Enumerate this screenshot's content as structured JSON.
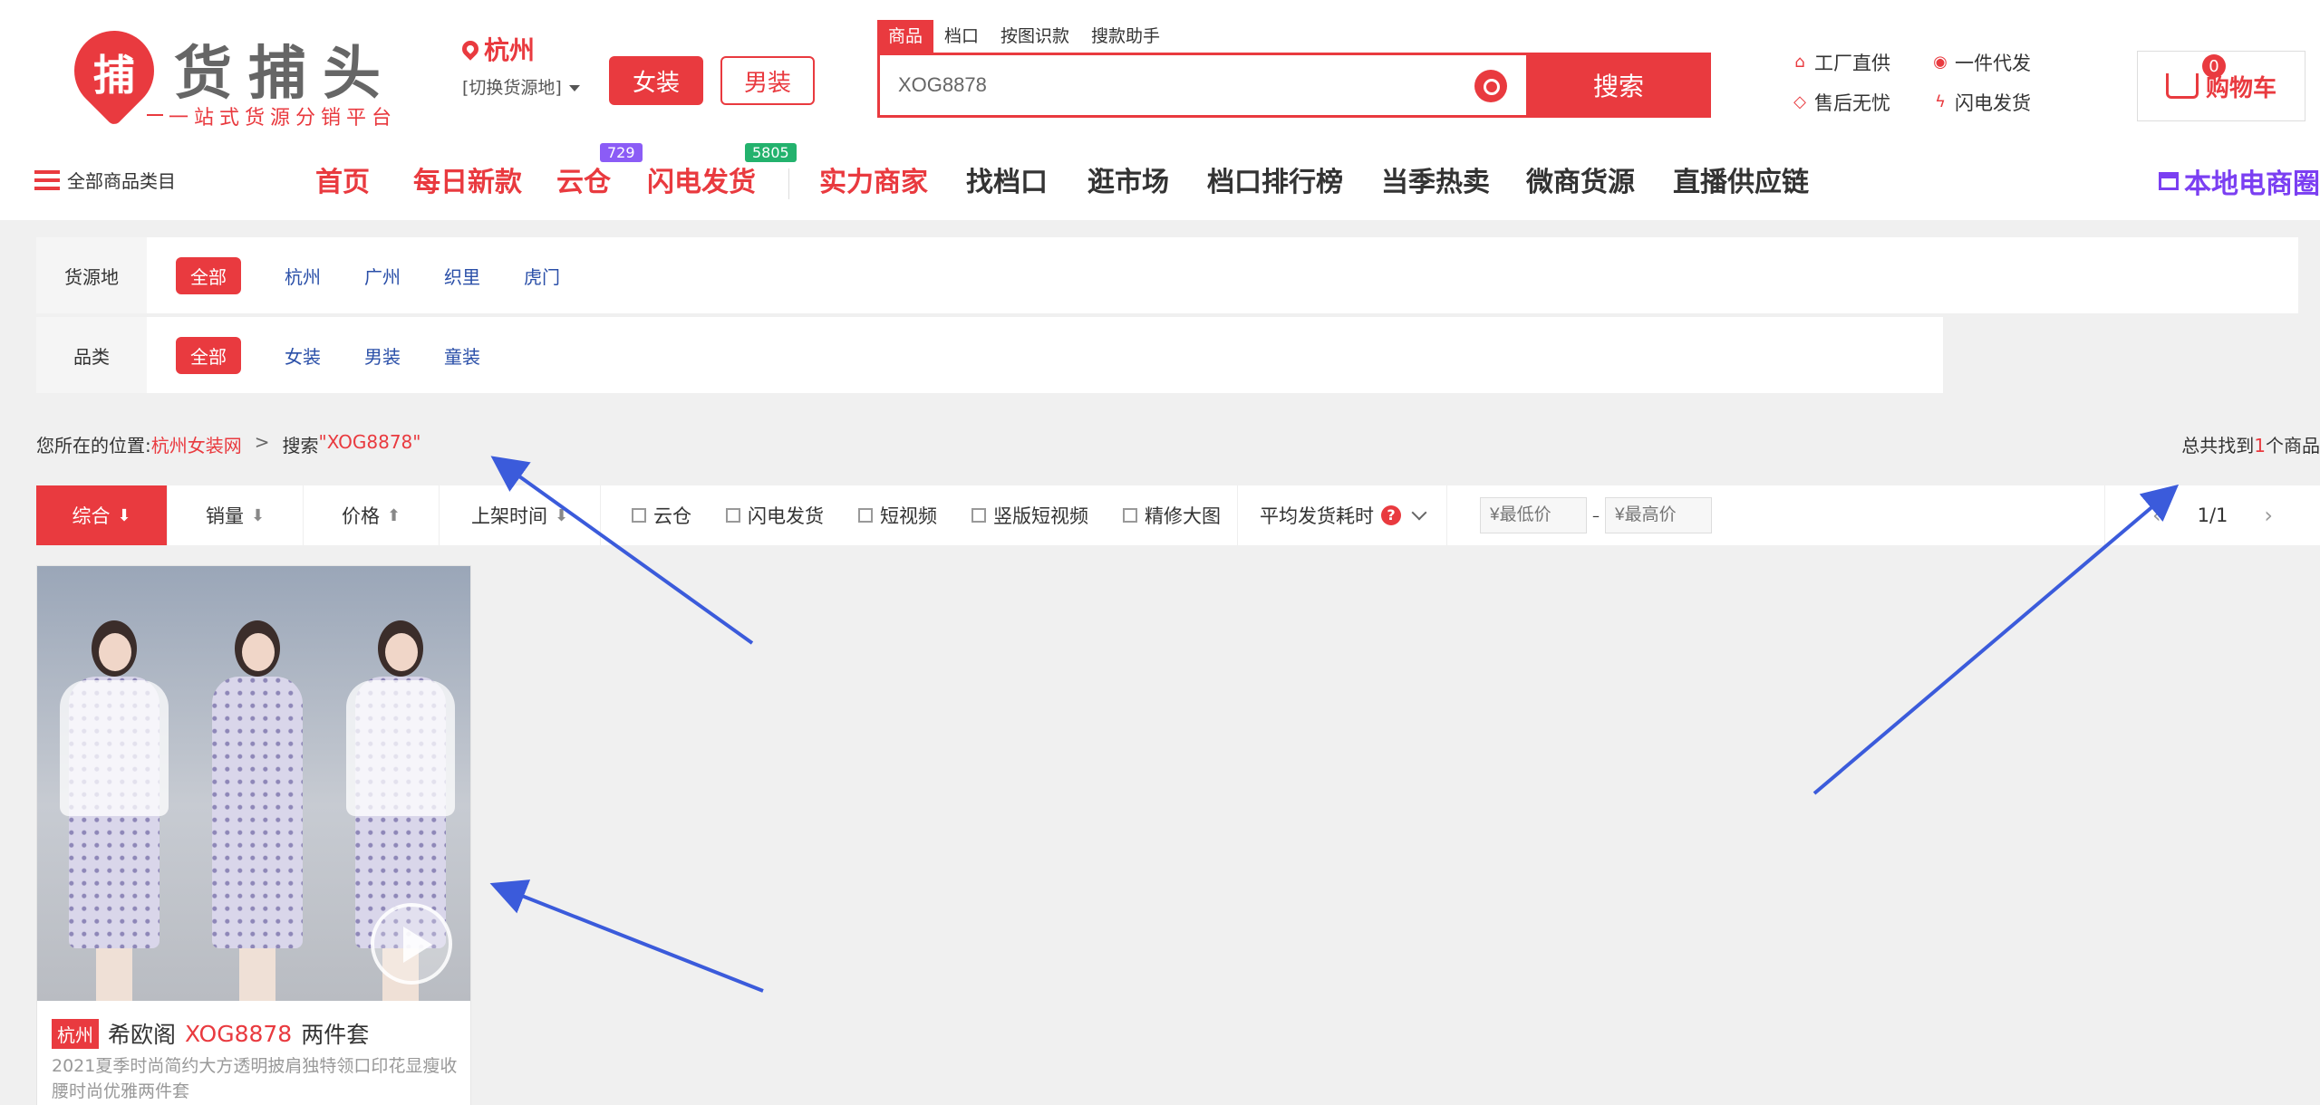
{
  "header": {
    "logo_title": "货捕头",
    "logo_subtitle": "一站式货源分销平台",
    "logo_mark": "捕",
    "location": {
      "city": "杭州",
      "switch_label": "[切换货源地]"
    },
    "gender": {
      "women": "女装",
      "men": "男装"
    },
    "search": {
      "tabs": [
        "商品",
        "档口",
        "按图识款",
        "搜款助手"
      ],
      "value": "XOG8878",
      "button": "搜索"
    },
    "features": [
      "工厂直供",
      "一件代发",
      "售后无忧",
      "闪电发货"
    ],
    "cart": {
      "label": "购物车",
      "count": "0"
    }
  },
  "nav": {
    "all_categories": "全部商品类目",
    "items": [
      "首页",
      "每日新款",
      "云仓",
      "闪电发货",
      "实力商家",
      "找档口",
      "逛市场",
      "档口排行榜",
      "当季热卖",
      "微商货源",
      "直播供应链"
    ],
    "badges": {
      "cloud": "729",
      "flash": "5805"
    },
    "right": "本地电商圈"
  },
  "filters": {
    "source": {
      "label": "货源地",
      "options": [
        "全部",
        "杭州",
        "广州",
        "织里",
        "虎门"
      ]
    },
    "category": {
      "label": "品类",
      "options": [
        "全部",
        "女装",
        "男装",
        "童装"
      ]
    }
  },
  "breadcrumb": {
    "prefix": "您所在的位置:",
    "link": "杭州女装网",
    "sep": ">",
    "search_prefix": "搜索",
    "keyword": "\"XOG8878\"",
    "total_prefix": "总共找到",
    "total_num": "1",
    "total_suffix": "个商品"
  },
  "sortbar": {
    "sorts": [
      "综合",
      "销量",
      "价格",
      "上架时间"
    ],
    "checks": [
      "云仓",
      "闪电发货",
      "短视频",
      "竖版短视频",
      "精修大图"
    ],
    "ship_time": "平均发货耗时",
    "min_price": "¥最低价",
    "max_price": "¥最高价",
    "price_sep": "–",
    "page": "1/1"
  },
  "product": {
    "city": "杭州",
    "brand": "希欧阁",
    "code": "XOG8878",
    "suffix": "两件套",
    "desc": "2021夏季时尚简约大方透明披肩独特领口印花显瘦收腰时尚优雅两件套"
  },
  "colors": {
    "accent": "#e93a3f",
    "nav_purple": "#7b3ff2",
    "annotation": "#3b5bdb"
  }
}
